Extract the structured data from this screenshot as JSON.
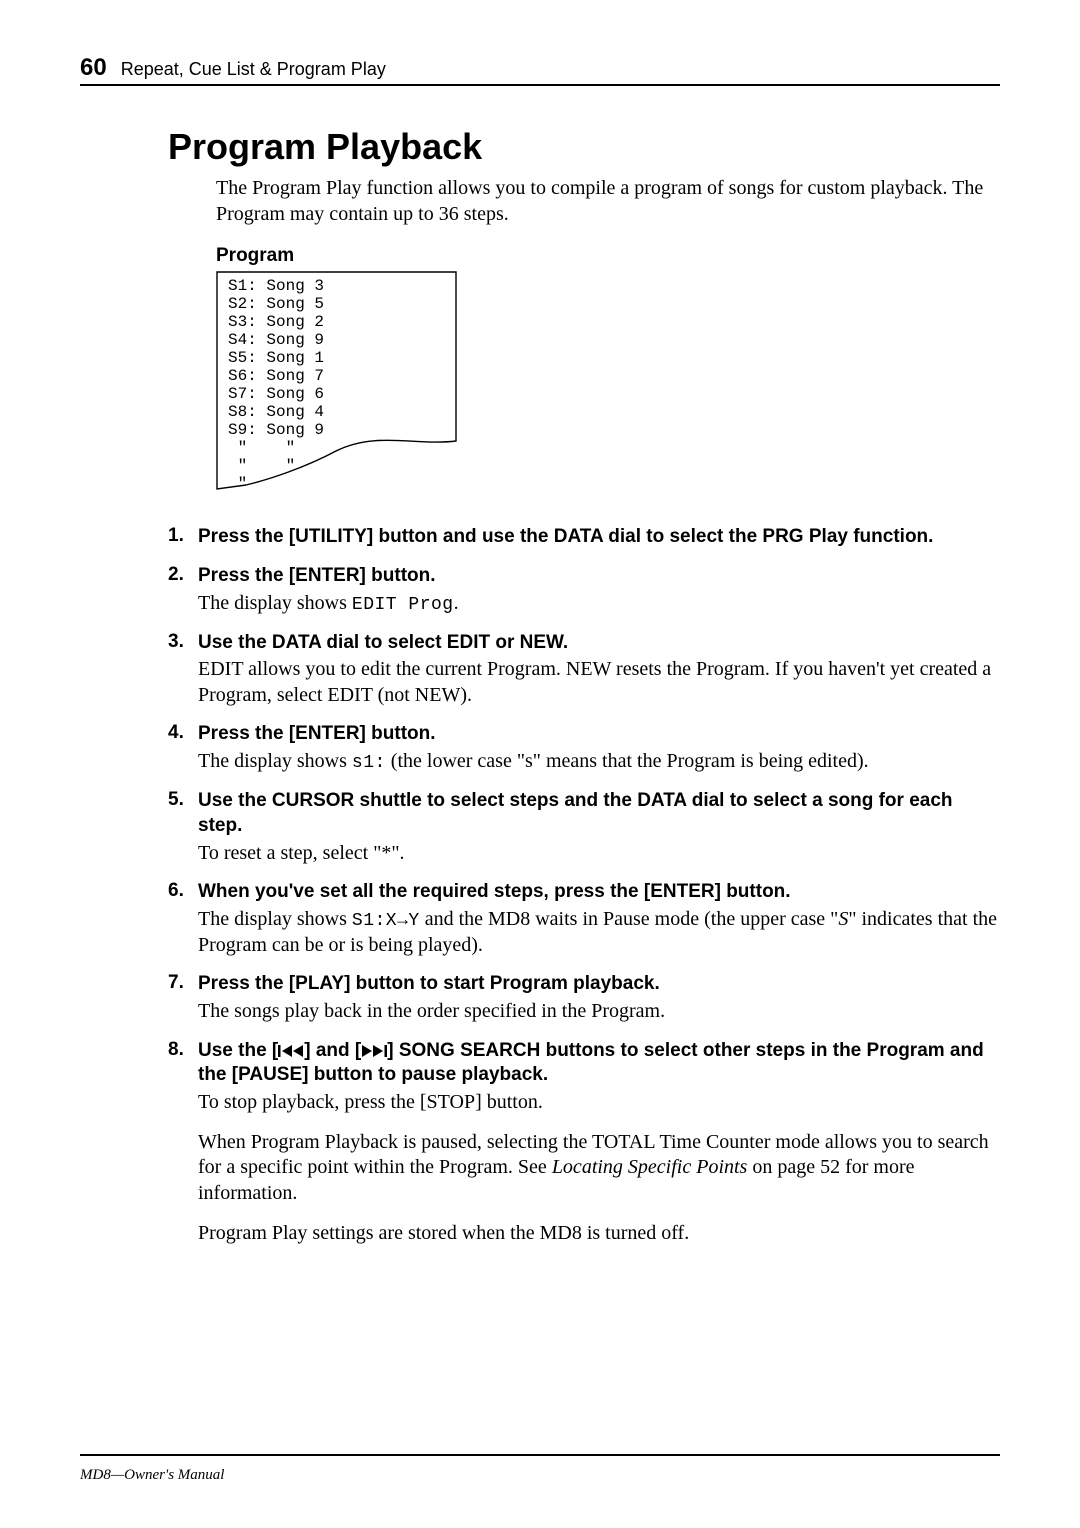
{
  "page_number": "60",
  "chapter": "Repeat, Cue List & Program Play",
  "section_title": "Program Playback",
  "intro": "The Program Play function allows you to compile a program of songs for custom playback. The Program may contain up to 36 steps.",
  "program": {
    "label": "Program",
    "entries": [
      "S1: Song 3",
      "S2: Song 5",
      "S3: Song 2",
      "S4: Song 9",
      "S5: Song 1",
      "S6: Song 7",
      "S7: Song 6",
      "S8: Song 4",
      "S9: Song 9",
      " \"    \"",
      " \"    \"",
      " \""
    ]
  },
  "steps": [
    {
      "head": "Press the [UTILITY] button and use the DATA dial to select the PRG Play function.",
      "body_parts": []
    },
    {
      "head": "Press the [ENTER] button.",
      "body_parts": [
        {
          "type": "display_line",
          "prefix": "The display shows ",
          "lcd": "EDIT Prog",
          "suffix": "."
        }
      ]
    },
    {
      "head": "Use the DATA dial to select EDIT or NEW.",
      "body_parts": [
        {
          "type": "text",
          "text": "EDIT allows you to edit the current Program. NEW resets the Program. If you haven't yet created a Program, select EDIT (not NEW)."
        }
      ]
    },
    {
      "head": "Press the [ENTER] button.",
      "body_parts": [
        {
          "type": "display_line",
          "prefix": "The display shows ",
          "lcd": "s1:",
          "suffix": " (the lower case \"s\" means that the Program is being edited)."
        }
      ]
    },
    {
      "head": "Use the CURSOR shuttle to select steps and the DATA dial to select a song for each step.",
      "body_parts": [
        {
          "type": "text",
          "text": "To reset a step, select \"*\"."
        }
      ]
    },
    {
      "head": "When you've set all the required steps, press the [ENTER] button.",
      "body_parts": [
        {
          "type": "display_line_s",
          "prefix": "The display shows ",
          "lcd": "S1:X→Y",
          "mid": " and the MD8 waits in Pause mode (the upper case \"",
          "sitalic": "S",
          "tail": "\" indicates that the Program can be or is being played)."
        }
      ]
    },
    {
      "head": "Press the [PLAY] button to start Program playback.",
      "body_parts": [
        {
          "type": "text",
          "text": "The songs play back in the order specified in the Program."
        }
      ]
    },
    {
      "head_parts": {
        "pre": "Use the [",
        "icon1": "skip-back",
        "mid1": "] and [",
        "icon2": "skip-fwd",
        "post": "] SONG SEARCH buttons to select other steps in the Program and the [PAUSE] button to pause playback."
      },
      "body_parts": [
        {
          "type": "text",
          "text": "To stop playback, press the [STOP] button."
        },
        {
          "type": "rich",
          "pre": "When Program Playback is paused, selecting the TOTAL Time Counter mode allows you to search for a specific point within the Program. See ",
          "italic": "Locating Specific Points",
          "post": " on page 52 for more information."
        },
        {
          "type": "text",
          "text": "Program Play settings are stored when the MD8 is turned off."
        }
      ]
    }
  ],
  "footer": "MD8—Owner's Manual"
}
